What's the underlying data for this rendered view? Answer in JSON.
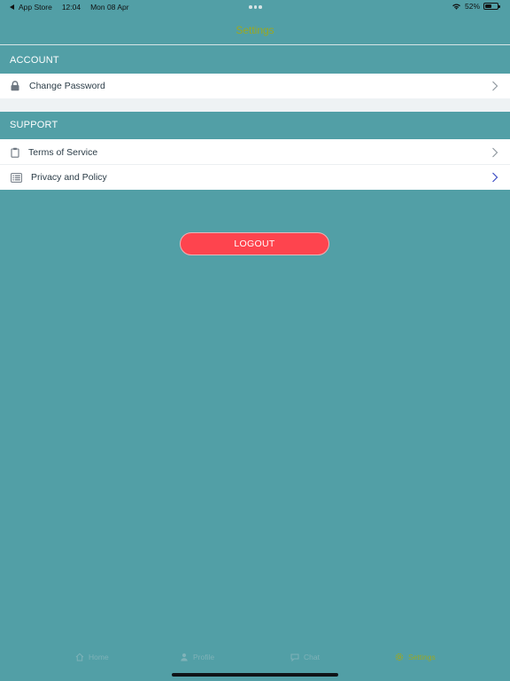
{
  "status_bar": {
    "back_app": "App Store",
    "time": "12:04",
    "date": "Mon 08 Apr",
    "battery": "52%",
    "battery_level": 0.52,
    "icons": [
      "wifi-icon",
      "battery-icon"
    ]
  },
  "nav": {
    "title": "Settings"
  },
  "sections": {
    "account": {
      "header": "ACCOUNT",
      "items": [
        {
          "label": "Change Password",
          "icon": "lock-icon"
        }
      ]
    },
    "support": {
      "header": "SUPPORT",
      "items": [
        {
          "label": "Terms of Service",
          "icon": "clipboard-icon"
        },
        {
          "label": "Privacy and Policy",
          "icon": "list-icon"
        }
      ]
    }
  },
  "logout": {
    "label": "LOGOUT"
  },
  "tab_bar": {
    "items": [
      {
        "label": "Home",
        "icon": "home-icon",
        "active": false
      },
      {
        "label": "Profile",
        "icon": "person-icon",
        "active": false
      },
      {
        "label": "Chat",
        "icon": "chat-icon",
        "active": false
      },
      {
        "label": "Settings",
        "icon": "gear-icon",
        "active": true
      }
    ]
  },
  "colors": {
    "background": "#529fa6",
    "accent": "#9aa823",
    "logout": "#fe444e",
    "chevron_highlight": "#3b4cc4"
  }
}
